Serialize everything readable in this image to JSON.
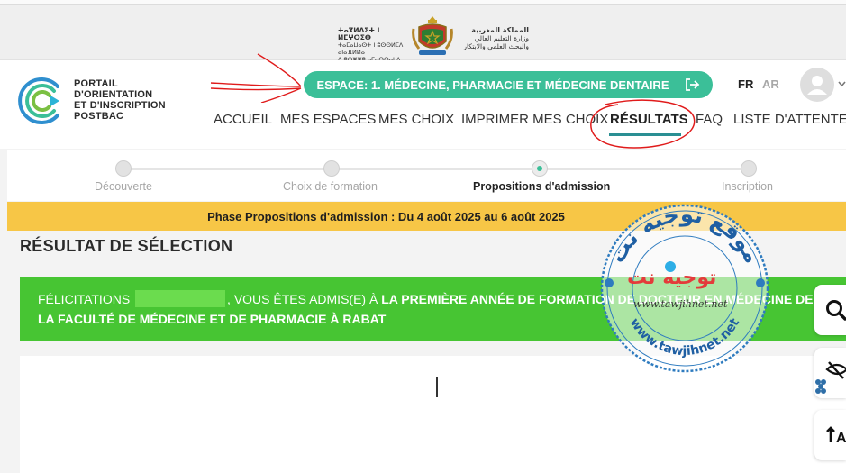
{
  "ministry": {
    "tifinagh_lines": [
      "ⵜⴰⴳⵍⴷⵉⵜ ⵏ ⵍⵎⵖⵔⵉⴱ",
      "ⵜⴰⵎⴰⵡⴰⵙⵜ ⵏ ⵓⵙⵙⵍⵎⴷ ⴰⵏⴰⴼⵍⵍⴰ",
      "ⴷ ⵓⵔⵣⵣⵓ ⴰⵎⴰⵙⵙⴰⵏ ⴷ ⵓⵙⵏⴼⵍⵍⵉ"
    ],
    "arabic_lines": [
      "المملكة المغربية",
      "وزارة التعليم العالي",
      "والبحث العلمي والابتكار"
    ]
  },
  "logo": {
    "lines": [
      "PORTAIL",
      "D'ORIENTATION",
      "ET D'INSCRIPTION",
      "POSTBAC"
    ]
  },
  "espace": {
    "label": "ESPACE: 1. MÉDECINE, PHARMACIE ET MÉDECINE DENTAIRE",
    "icon": "logout-icon"
  },
  "lang": {
    "fr": "FR",
    "ar": "AR"
  },
  "nav": {
    "items": [
      "ACCUEIL",
      "MES ESPACES",
      "MES CHOIX",
      "IMPRIMER MES CHOIX",
      "RÉSULTATS",
      "FAQ",
      "LISTE D'ATTENTE"
    ],
    "active": "RÉSULTATS"
  },
  "stepper": {
    "steps": [
      "Découverte",
      "Choix de formation",
      "Propositions d'admission",
      "Inscription"
    ],
    "active_index": 2
  },
  "phase": {
    "text": "Phase Propositions d'admission : Du 4 août 2025 au 6 août 2025"
  },
  "result": {
    "title": "RÉSULTAT DE SÉLECTION",
    "line1_prefix": "FÉLICITATIONS",
    "line1_mid": ", VOUS ÊTES ADMIS(E) À",
    "line1_bold": "LA PREMIÈRE ANNÉE DE FORMATION DE DOCTEUR EN MÉDECINE DE",
    "line2_bold": "LA FACULTÉ DE MÉDECINE ET DE PHARMACIE À RABAT"
  },
  "watermark": {
    "arc_text": "موقع توجيه نت",
    "logo_text": "توجيه نت",
    "url": "www.tawjihnet.net",
    "bottom_arc": "www.tawjihnet.net"
  },
  "side_tools": [
    "search-icon",
    "accessibility-icon",
    "text-size-icon"
  ],
  "colors": {
    "accent": "#3bbf98",
    "phase": "#f7c646",
    "success": "#47c533",
    "annotation": "#e01b1b",
    "nav_underline": "#2a8f93"
  }
}
